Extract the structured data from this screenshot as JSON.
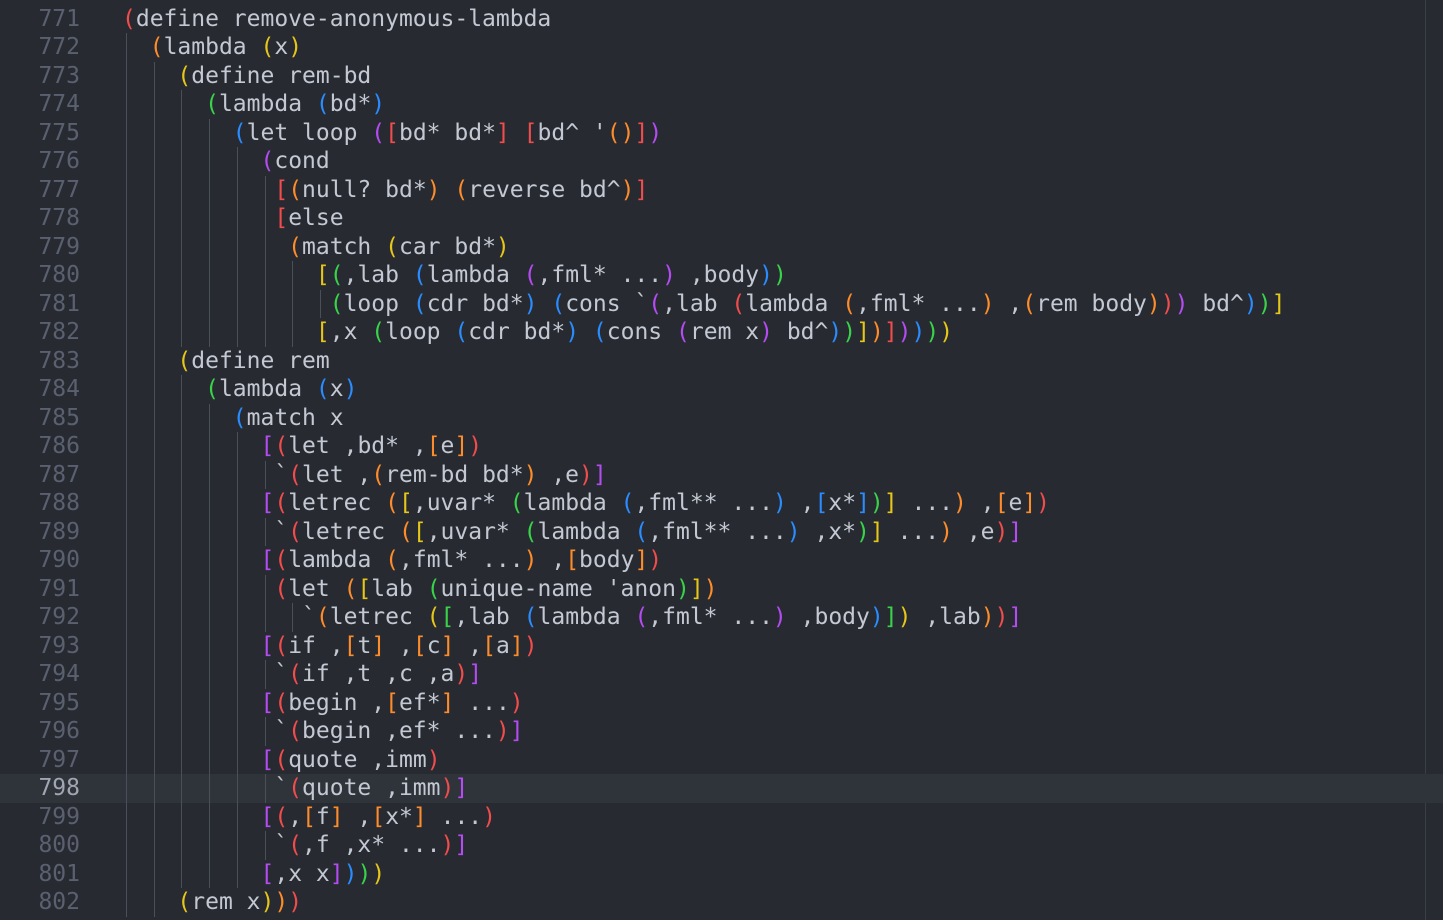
{
  "editor": {
    "current_line": "798",
    "lines": [
      {
        "n": "771",
        "t": "(define remove-anonymous-lambda"
      },
      {
        "n": "772",
        "t": "  (lambda (x)"
      },
      {
        "n": "773",
        "t": "    (define rem-bd"
      },
      {
        "n": "774",
        "t": "      (lambda (bd*)"
      },
      {
        "n": "775",
        "t": "        (let loop ([bd* bd*] [bd^ '()])"
      },
      {
        "n": "776",
        "t": "          (cond"
      },
      {
        "n": "777",
        "t": "           [(null? bd*) (reverse bd^)]"
      },
      {
        "n": "778",
        "t": "           [else"
      },
      {
        "n": "779",
        "t": "            (match (car bd*)"
      },
      {
        "n": "780",
        "t": "              [(,lab (lambda (,fml* ...) ,body))"
      },
      {
        "n": "781",
        "t": "               (loop (cdr bd*) (cons `(,lab (lambda (,fml* ...) ,(rem body))) bd^))]"
      },
      {
        "n": "782",
        "t": "              [,x (loop (cdr bd*) (cons (rem x) bd^))])]))))"
      },
      {
        "n": "783",
        "t": "    (define rem"
      },
      {
        "n": "784",
        "t": "      (lambda (x)"
      },
      {
        "n": "785",
        "t": "        (match x"
      },
      {
        "n": "786",
        "t": "          [(let ,bd* ,[e])"
      },
      {
        "n": "787",
        "t": "           `(let ,(rem-bd bd*) ,e)]"
      },
      {
        "n": "788",
        "t": "          [(letrec ([,uvar* (lambda (,fml** ...) ,[x*])] ...) ,[e])"
      },
      {
        "n": "789",
        "t": "           `(letrec ([,uvar* (lambda (,fml** ...) ,x*)] ...) ,e)]"
      },
      {
        "n": "790",
        "t": "          [(lambda (,fml* ...) ,[body])"
      },
      {
        "n": "791",
        "t": "           (let ([lab (unique-name 'anon)])"
      },
      {
        "n": "792",
        "t": "             `(letrec ([,lab (lambda (,fml* ...) ,body)]) ,lab))]"
      },
      {
        "n": "793",
        "t": "          [(if ,[t] ,[c] ,[a])"
      },
      {
        "n": "794",
        "t": "           `(if ,t ,c ,a)]"
      },
      {
        "n": "795",
        "t": "          [(begin ,[ef*] ...)"
      },
      {
        "n": "796",
        "t": "           `(begin ,ef* ...)]"
      },
      {
        "n": "797",
        "t": "          [(quote ,imm)"
      },
      {
        "n": "798",
        "t": "           `(quote ,imm)]"
      },
      {
        "n": "799",
        "t": "          [(,[f] ,[x*] ...)"
      },
      {
        "n": "800",
        "t": "           `(,f ,x* ...)]"
      },
      {
        "n": "801",
        "t": "          [,x x])))"
      },
      {
        "n": "802",
        "t": "    (rem x)))"
      }
    ]
  },
  "colors": {
    "background": "#272b31",
    "current_line_bg": "#2f343b",
    "line_number": "#5a6070",
    "plain_text": "#c3c8d2",
    "bracket_depth": [
      "#f24c4c",
      "#ff8c2a",
      "#e6c619",
      "#39d34a",
      "#2a8cff",
      "#b44cf2"
    ]
  }
}
